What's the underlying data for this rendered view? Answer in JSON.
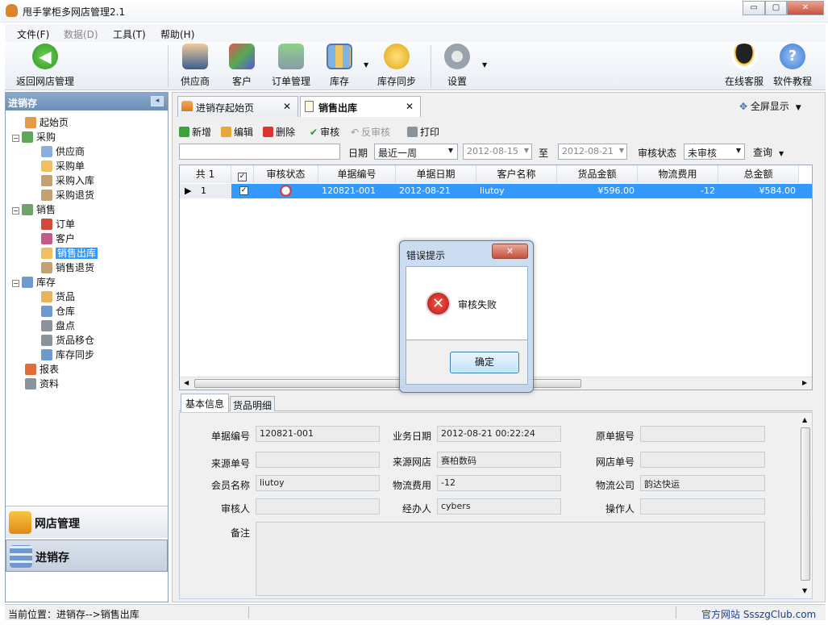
{
  "app": {
    "title": "甩手掌柜多网店管理2.1",
    "min": "▭",
    "max": "▢",
    "close": "✕"
  },
  "menu": [
    "文件(F)",
    "数据(D)",
    "工具(T)",
    "帮助(H)"
  ],
  "toolbar": {
    "back": "返回网店管理",
    "supplier": "供应商",
    "customer": "客户",
    "orders": "订单管理",
    "stock": "库存",
    "stocksync": "库存同步",
    "settings": "设置",
    "support": "在线客服",
    "tutorial": "软件教程"
  },
  "sidebar": {
    "title": "进销存",
    "tree": [
      "起始页",
      "采购",
      "供应商",
      "采购单",
      "采购入库",
      "采购退货",
      "销售",
      "订单",
      "客户",
      "销售出库",
      "销售退货",
      "库存",
      "货品",
      "仓库",
      "盘点",
      "货品移仓",
      "库存同步",
      "报表",
      "资料"
    ],
    "nav1": "网店管理",
    "nav2": "进销存"
  },
  "tabs": {
    "tab1": "进销存起始页",
    "tab2": "销售出库",
    "fullscreen": "全屏显示"
  },
  "actions": {
    "add": "新增",
    "edit": "编辑",
    "delete": "删除",
    "approve": "审核",
    "unapprove": "反审核",
    "print": "打印"
  },
  "filter": {
    "date_label": "日期",
    "range": "最近一周",
    "from": "2012-08-15",
    "to_label": "至",
    "to": "2012-08-21",
    "status_label": "审核状态",
    "status": "未审核",
    "query": "查询"
  },
  "grid": {
    "headers": [
      "共 1",
      "",
      "审核状态",
      "单据编号",
      "单据日期",
      "客户名称",
      "货品金额",
      "物流费用",
      "总金额"
    ],
    "row": {
      "num": "1",
      "id": "120821-001",
      "date": "2012-08-21",
      "customer": "liutoy",
      "goods": "¥596.00",
      "freight": "-12",
      "total": "¥584.00"
    }
  },
  "detail_tabs": {
    "basic": "基本信息",
    "items": "货品明细"
  },
  "form": {
    "l_docno": "单据编号",
    "docno": "120821-001",
    "l_bizdate": "业务日期",
    "bizdate": "2012-08-21 00:22:24",
    "l_origno": "原单据号",
    "origno": "",
    "l_srcno": "来源单号",
    "srcno": "",
    "l_srcshop": "来源网店",
    "srcshop": "赛柏数码",
    "l_shopno": "网店单号",
    "shopno": "",
    "l_member": "会员名称",
    "member": "liutoy",
    "l_freight": "物流费用",
    "freight": "-12",
    "l_logistics": "物流公司",
    "logistics": "韵达快运",
    "l_auditor": "审核人",
    "auditor": "",
    "l_handler": "经办人",
    "handler": "cybers",
    "l_operator": "操作人",
    "operator": "",
    "l_remark": "备注",
    "remark": ""
  },
  "dialog": {
    "title": "错误提示",
    "message": "审核失败",
    "ok": "确定",
    "close": "✕"
  },
  "status": {
    "location": "当前位置：进销存-->销售出库",
    "site": "官方网站 SsszgClub.com"
  }
}
